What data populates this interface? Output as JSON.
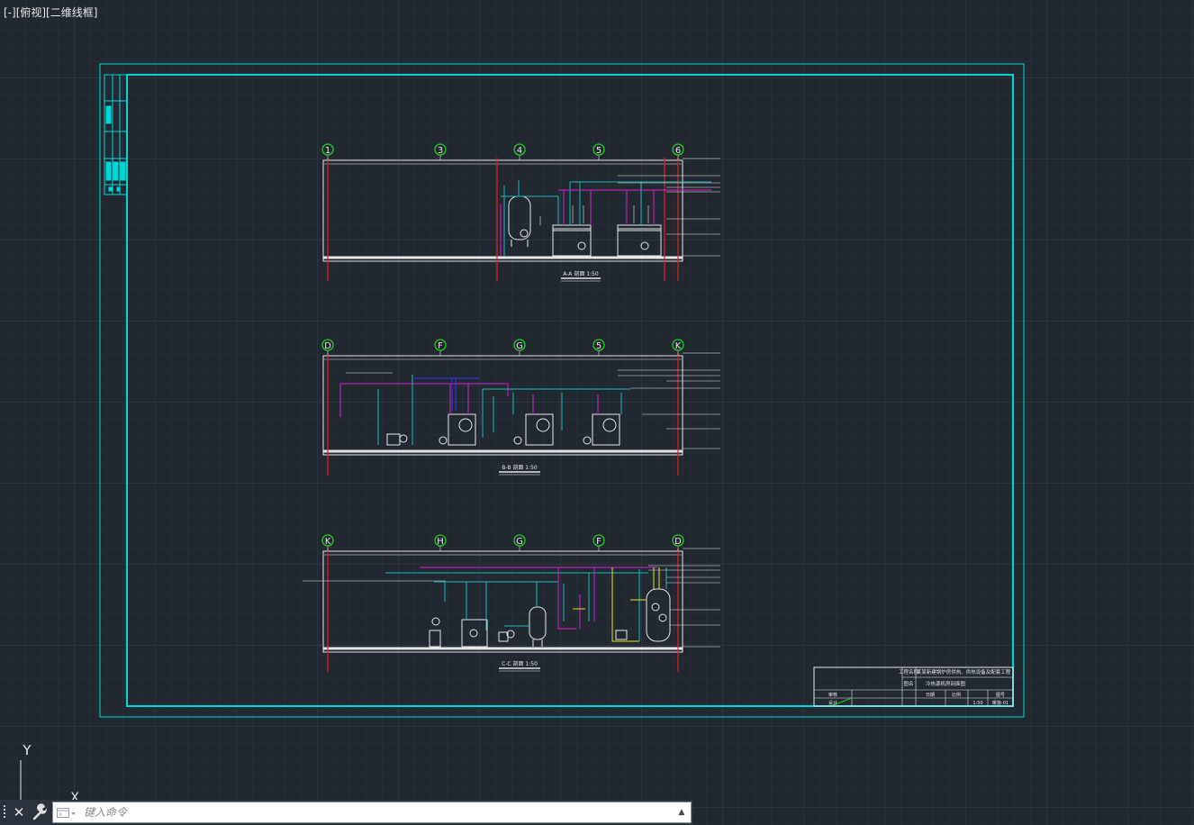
{
  "viewport": {
    "label": "[-][俯视][二维线框]"
  },
  "colors": {
    "background": "#212830",
    "sheet_border": "#00d8d8",
    "axis_bubble": "#22cc22",
    "gridline": "#e02020",
    "pipe_cyan": "#19b8b8",
    "pipe_magenta": "#d020d0",
    "pipe_yellow": "#e8e020",
    "pipe_blue": "#3030e0",
    "equipment_white": "#e6e6e6"
  },
  "ucs": {
    "y_label": "Y",
    "x_label": "X"
  },
  "sections": [
    {
      "axes": [
        "1",
        "3",
        "4",
        "5",
        "6"
      ],
      "title": "A-A 剖面 1:50"
    },
    {
      "axes": [
        "D",
        "F",
        "G",
        "5",
        "K"
      ],
      "title": "B-B 剖面 1:50"
    },
    {
      "axes": [
        "K",
        "H",
        "G",
        "F",
        "D"
      ],
      "title": "C-C 剖面 1:50"
    }
  ],
  "title_block": {
    "project_label": "工程名称",
    "project_name": "某某新建锅炉房供热、供热设备及配套工程",
    "drawing_label": "图名",
    "drawing_name": "冷热源机房剖面图",
    "checked_label": "审核",
    "designed_label": "设计",
    "check_date_label": "日期",
    "sheet_label": "图号",
    "scale_label": "比例",
    "scale_value": "1:50",
    "sheet_no": "暖施-01"
  },
  "command_line": {
    "placeholder": "键入命令",
    "close_icon": "close-icon",
    "customize_icon": "wrench-icon"
  }
}
